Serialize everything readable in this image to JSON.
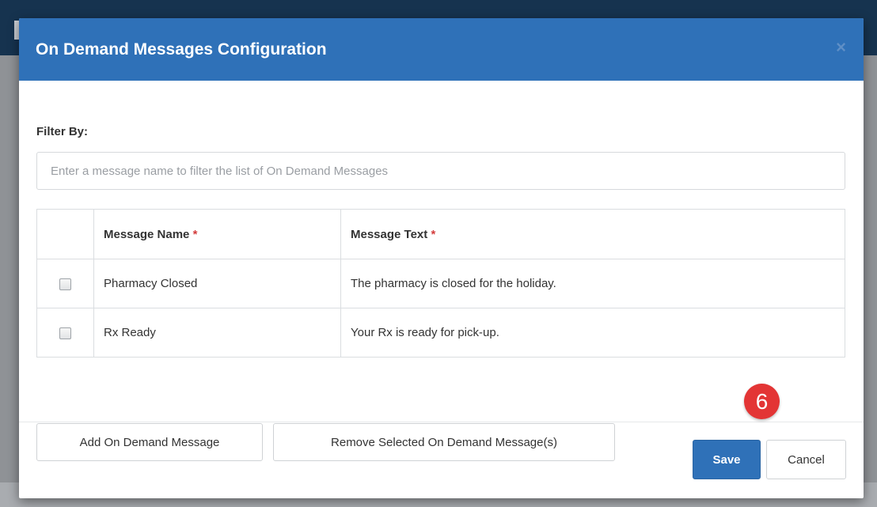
{
  "modal": {
    "title": "On Demand Messages Configuration",
    "close_glyph": "×"
  },
  "filter": {
    "label": "Filter By:",
    "placeholder": "Enter a message name to filter the list of On Demand Messages",
    "value": ""
  },
  "table": {
    "headers": {
      "name": "Message Name",
      "text": "Message Text",
      "required_marker": "*"
    },
    "rows": [
      {
        "checked": false,
        "name": "Pharmacy Closed",
        "text": "The pharmacy is closed for the holiday."
      },
      {
        "checked": false,
        "name": "Rx Ready",
        "text": "Your Rx is ready for pick-up."
      }
    ]
  },
  "actions": {
    "add_label": "Add On Demand Message",
    "remove_label": "Remove Selected On Demand Message(s)"
  },
  "footer": {
    "save_label": "Save",
    "cancel_label": "Cancel"
  },
  "annotation": {
    "step_number": "6"
  },
  "colors": {
    "header_bg": "#2f71b8",
    "primary_button": "#2f71b8",
    "required_marker": "#d33c3c",
    "step_badge": "#e33535"
  }
}
